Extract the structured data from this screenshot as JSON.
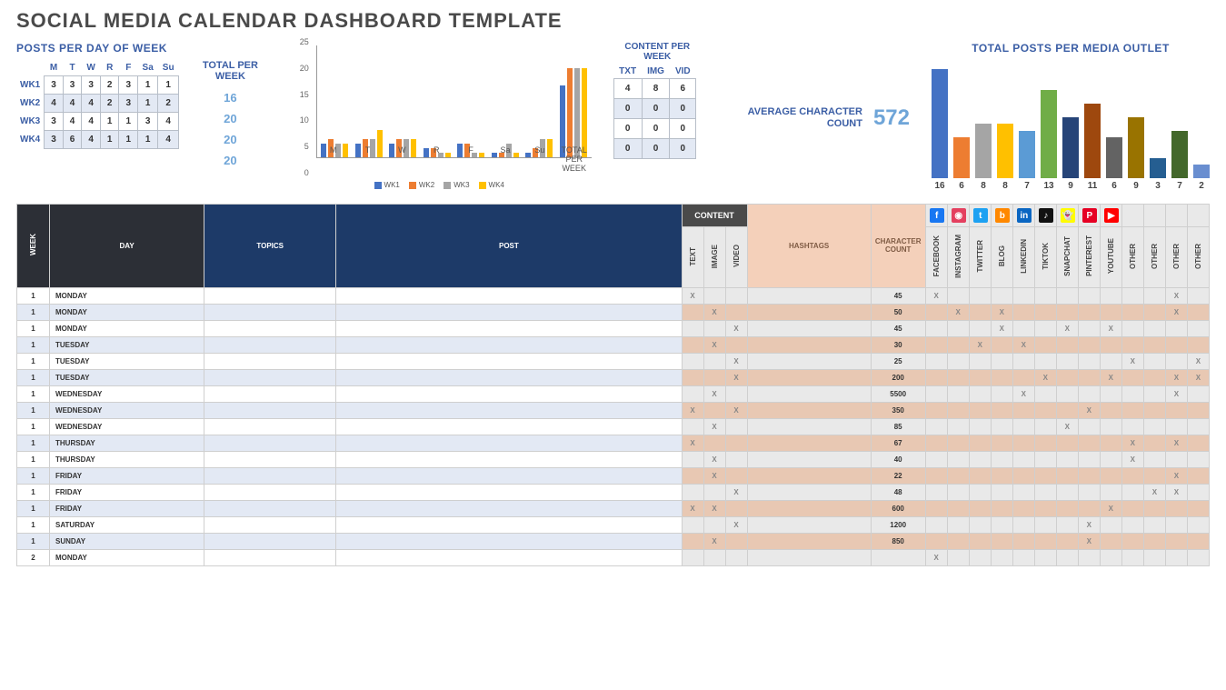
{
  "title": "SOCIAL MEDIA CALENDAR DASHBOARD TEMPLATE",
  "ppdw": {
    "title": "POSTS PER DAY OF WEEK",
    "days": [
      "M",
      "T",
      "W",
      "R",
      "F",
      "Sa",
      "Su"
    ],
    "rows": [
      {
        "wk": "WK1",
        "v": [
          3,
          3,
          3,
          2,
          3,
          1,
          1
        ]
      },
      {
        "wk": "WK2",
        "v": [
          4,
          4,
          4,
          2,
          3,
          1,
          2
        ]
      },
      {
        "wk": "WK3",
        "v": [
          3,
          4,
          4,
          1,
          1,
          3,
          4
        ]
      },
      {
        "wk": "WK4",
        "v": [
          3,
          6,
          4,
          1,
          1,
          1,
          4
        ]
      }
    ],
    "total_head": "TOTAL PER WEEK",
    "totals": [
      16,
      20,
      20,
      20
    ]
  },
  "chart_data": {
    "type": "bar",
    "categories": [
      "M",
      "T",
      "W",
      "R",
      "F",
      "Sa",
      "Su",
      "TOTAL PER WEEK"
    ],
    "series": [
      {
        "name": "WK1",
        "values": [
          3,
          3,
          3,
          2,
          3,
          1,
          1,
          16
        ]
      },
      {
        "name": "WK2",
        "values": [
          4,
          4,
          4,
          2,
          3,
          1,
          2,
          20
        ]
      },
      {
        "name": "WK3",
        "values": [
          3,
          4,
          4,
          1,
          1,
          3,
          4,
          20
        ]
      },
      {
        "name": "WK4",
        "values": [
          3,
          6,
          4,
          1,
          1,
          1,
          4,
          20
        ]
      }
    ],
    "ylim": [
      0,
      25
    ],
    "yticks": [
      0,
      5,
      10,
      15,
      20,
      25
    ]
  },
  "cpw": {
    "title": "CONTENT PER WEEK",
    "heads": [
      "TXT",
      "IMG",
      "VID"
    ],
    "rows": [
      [
        4,
        8,
        6
      ],
      [
        0,
        0,
        0
      ],
      [
        0,
        0,
        0
      ],
      [
        0,
        0,
        0
      ]
    ]
  },
  "avg": {
    "label": "AVERAGE CHARACTER COUNT",
    "value": "572"
  },
  "tpo": {
    "title": "TOTAL POSTS PER MEDIA OUTLET",
    "colors": [
      "#4472c4",
      "#ed7d31",
      "#a5a5a5",
      "#ffc000",
      "#5b9bd5",
      "#70ad47",
      "#264478",
      "#9e480e",
      "#636363",
      "#997300",
      "#255e91",
      "#43682b",
      "#698ed0"
    ],
    "values": [
      16,
      6,
      8,
      8,
      7,
      13,
      9,
      11,
      6,
      9,
      3,
      7,
      2
    ]
  },
  "table": {
    "headers": {
      "week": "WEEK",
      "day": "DAY",
      "topics": "TOPICS",
      "post": "POST",
      "content": "CONTENT",
      "text": "TEXT",
      "image": "IMAGE",
      "video": "VIDEO",
      "hashtags": "HASHTAGS",
      "char": "CHARACTER COUNT"
    },
    "outlets": [
      "FACEBOOK",
      "INSTAGRAM",
      "TWITTER",
      "BLOG",
      "LINKEDIN",
      "TIKTOK",
      "SNAPCHAT",
      "PINTEREST",
      "YOUTUBE",
      "OTHER",
      "OTHER",
      "OTHER",
      "OTHER"
    ],
    "icons": [
      {
        "bg": "#1877f2",
        "t": "f"
      },
      {
        "bg": "#e4405f",
        "t": "◉"
      },
      {
        "bg": "#1da1f2",
        "t": "t"
      },
      {
        "bg": "#ff8800",
        "t": "b"
      },
      {
        "bg": "#0a66c2",
        "t": "in"
      },
      {
        "bg": "#111",
        "t": "♪"
      },
      {
        "bg": "#fffc00",
        "t": "👻"
      },
      {
        "bg": "#e60023",
        "t": "P"
      },
      {
        "bg": "#ff0000",
        "t": "▶"
      },
      {
        "bg": "",
        "t": ""
      },
      {
        "bg": "",
        "t": ""
      },
      {
        "bg": "",
        "t": ""
      },
      {
        "bg": "",
        "t": ""
      }
    ],
    "rows": [
      {
        "w": 1,
        "d": "MONDAY",
        "t": 1,
        "i": 0,
        "v": 0,
        "c": 45,
        "o": [
          1,
          0,
          0,
          0,
          0,
          0,
          0,
          0,
          0,
          0,
          0,
          1,
          0
        ]
      },
      {
        "w": 1,
        "d": "MONDAY",
        "t": 0,
        "i": 1,
        "v": 0,
        "c": 50,
        "o": [
          0,
          1,
          0,
          1,
          0,
          0,
          0,
          0,
          0,
          0,
          0,
          1,
          0
        ]
      },
      {
        "w": 1,
        "d": "MONDAY",
        "t": 0,
        "i": 0,
        "v": 1,
        "c": 45,
        "o": [
          0,
          0,
          0,
          1,
          0,
          0,
          1,
          0,
          1,
          0,
          0,
          0,
          0
        ]
      },
      {
        "w": 1,
        "d": "TUESDAY",
        "t": 0,
        "i": 1,
        "v": 0,
        "c": 30,
        "o": [
          0,
          0,
          1,
          0,
          1,
          0,
          0,
          0,
          0,
          0,
          0,
          0,
          0
        ]
      },
      {
        "w": 1,
        "d": "TUESDAY",
        "t": 0,
        "i": 0,
        "v": 1,
        "c": 25,
        "o": [
          0,
          0,
          0,
          0,
          0,
          0,
          0,
          0,
          0,
          1,
          0,
          0,
          1
        ]
      },
      {
        "w": 1,
        "d": "TUESDAY",
        "t": 0,
        "i": 0,
        "v": 1,
        "c": 200,
        "o": [
          0,
          0,
          0,
          0,
          0,
          1,
          0,
          0,
          1,
          0,
          0,
          1,
          1
        ]
      },
      {
        "w": 1,
        "d": "WEDNESDAY",
        "t": 0,
        "i": 1,
        "v": 0,
        "c": 5500,
        "o": [
          0,
          0,
          0,
          0,
          1,
          0,
          0,
          0,
          0,
          0,
          0,
          1,
          0
        ]
      },
      {
        "w": 1,
        "d": "WEDNESDAY",
        "t": 1,
        "i": 0,
        "v": 1,
        "c": 350,
        "o": [
          0,
          0,
          0,
          0,
          0,
          0,
          0,
          1,
          0,
          0,
          0,
          0,
          0
        ]
      },
      {
        "w": 1,
        "d": "WEDNESDAY",
        "t": 0,
        "i": 1,
        "v": 0,
        "c": 85,
        "o": [
          0,
          0,
          0,
          0,
          0,
          0,
          1,
          0,
          0,
          0,
          0,
          0,
          0
        ]
      },
      {
        "w": 1,
        "d": "THURSDAY",
        "t": 1,
        "i": 0,
        "v": 0,
        "c": 67,
        "o": [
          0,
          0,
          0,
          0,
          0,
          0,
          0,
          0,
          0,
          1,
          0,
          1,
          0
        ]
      },
      {
        "w": 1,
        "d": "THURSDAY",
        "t": 0,
        "i": 1,
        "v": 0,
        "c": 40,
        "o": [
          0,
          0,
          0,
          0,
          0,
          0,
          0,
          0,
          0,
          1,
          0,
          0,
          0
        ]
      },
      {
        "w": 1,
        "d": "FRIDAY",
        "t": 0,
        "i": 1,
        "v": 0,
        "c": 22,
        "o": [
          0,
          0,
          0,
          0,
          0,
          0,
          0,
          0,
          0,
          0,
          0,
          1,
          0
        ]
      },
      {
        "w": 1,
        "d": "FRIDAY",
        "t": 0,
        "i": 0,
        "v": 1,
        "c": 48,
        "o": [
          0,
          0,
          0,
          0,
          0,
          0,
          0,
          0,
          0,
          0,
          1,
          1,
          0
        ]
      },
      {
        "w": 1,
        "d": "FRIDAY",
        "t": 1,
        "i": 1,
        "v": 0,
        "c": 600,
        "o": [
          0,
          0,
          0,
          0,
          0,
          0,
          0,
          0,
          1,
          0,
          0,
          0,
          0
        ]
      },
      {
        "w": 1,
        "d": "SATURDAY",
        "t": 0,
        "i": 0,
        "v": 1,
        "c": 1200,
        "o": [
          0,
          0,
          0,
          0,
          0,
          0,
          0,
          1,
          0,
          0,
          0,
          0,
          0
        ]
      },
      {
        "w": 1,
        "d": "SUNDAY",
        "t": 0,
        "i": 1,
        "v": 0,
        "c": 850,
        "o": [
          0,
          0,
          0,
          0,
          0,
          0,
          0,
          1,
          0,
          0,
          0,
          0,
          0
        ]
      },
      {
        "w": 2,
        "d": "MONDAY",
        "t": 0,
        "i": 0,
        "v": 0,
        "c": "",
        "o": [
          1,
          0,
          0,
          0,
          0,
          0,
          0,
          0,
          0,
          0,
          0,
          0,
          0
        ]
      }
    ]
  }
}
